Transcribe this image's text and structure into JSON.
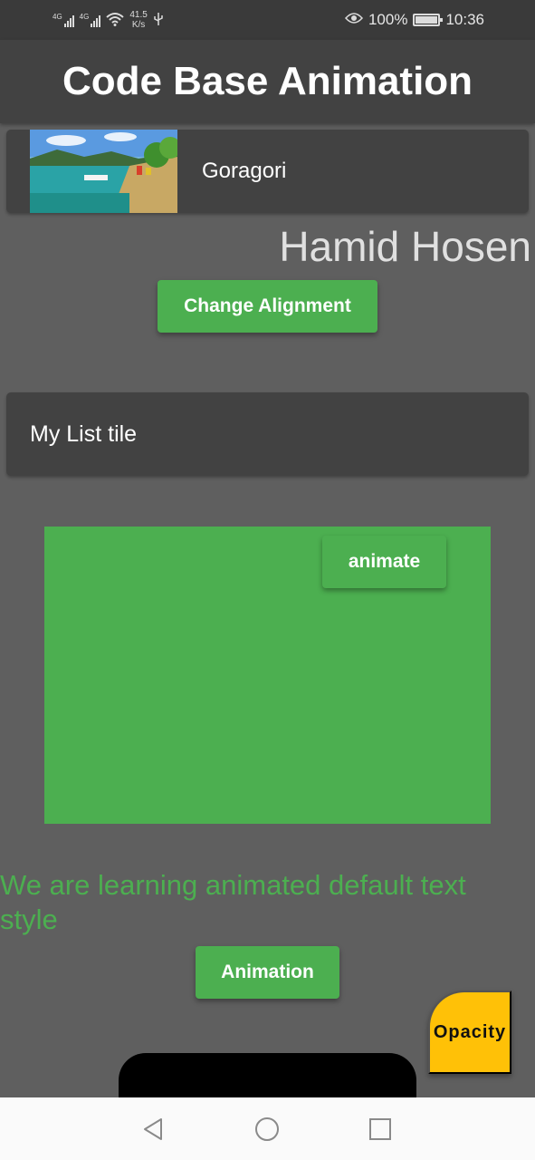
{
  "status_bar": {
    "signal_tag_1": "4G",
    "signal_tag_2": "4G",
    "speed_value": "41.5",
    "speed_unit": "K/s",
    "battery_percent": "100%",
    "time": "10:36",
    "icons": [
      "signal-icon",
      "wifi-icon",
      "usb-icon",
      "eye-icon",
      "battery-icon"
    ]
  },
  "app_bar": {
    "title": "Code Base Animation"
  },
  "card": {
    "title": "Goragori"
  },
  "name_text": "Hamid Hosen",
  "buttons": {
    "change_alignment": "Change Alignment",
    "animate": "animate",
    "animation": "Animation",
    "opacity": "Opacity"
  },
  "list_tile": {
    "title": "My List tile"
  },
  "animated_text": "We are learning animated default text style",
  "colors": {
    "background": "#5f5f5f",
    "surface": "#424242",
    "accent_green": "#4caf50",
    "fab_amber": "#ffc107"
  },
  "nav_bar": {
    "icons": [
      "back-icon",
      "home-icon",
      "recent-apps-icon"
    ]
  }
}
